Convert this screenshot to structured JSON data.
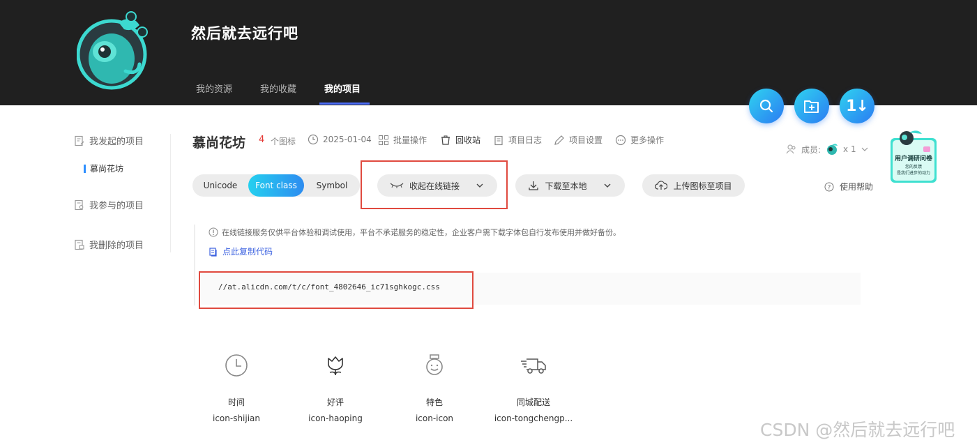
{
  "header": {
    "user_name": "然后就去远行吧",
    "tabs": [
      {
        "label": "我的资源"
      },
      {
        "label": "我的收藏"
      },
      {
        "label": "我的项目"
      }
    ],
    "actions": {
      "search_icon": "search-icon",
      "new_folder_icon": "folder-plus-icon",
      "sort_label": "1↓"
    }
  },
  "sidebar": {
    "initiated": "我发起的项目",
    "current_project": "慕尚花坊",
    "participated": "我参与的项目",
    "deleted": "我删除的项目"
  },
  "project": {
    "title": "慕尚花坊",
    "icon_count": "4",
    "icon_count_label": "个图标",
    "date": "2025-01-04",
    "batch_ops": "批量操作",
    "recycle": "回收站",
    "log": "项目日志",
    "settings": "项目设置",
    "more": "更多操作",
    "members_label": "成员:",
    "members_count": "x 1",
    "survey_title": "用户调研问卷",
    "survey_line1": "您的反馈",
    "survey_line2": "是我们进步的动力"
  },
  "toolbar": {
    "segments": [
      "Unicode",
      "Font class",
      "Symbol"
    ],
    "active_segment": "Font class",
    "collapse_link": "收起在线链接",
    "download": "下载至本地",
    "upload": "上传图标至项目",
    "help": "使用帮助"
  },
  "notice": {
    "text": "在线链接服务仅供平台体验和调试使用，平台不承诺服务的稳定性，企业客户需下载字体包自行发布使用并做好备份。",
    "copy_code": "点此复制代码"
  },
  "code": {
    "url": "//at.alicdn.com/t/c/font_4802646_ic71sghkogc.css"
  },
  "icons": [
    {
      "name": "时间",
      "class": "icon-shijian",
      "glyph": "clock-icon"
    },
    {
      "name": "好评",
      "class": "icon-haoping",
      "glyph": "tulip-icon"
    },
    {
      "name": "特色",
      "class": "icon-icon",
      "glyph": "medal-icon"
    },
    {
      "name": "同城配送",
      "class": "icon-tongchengp...",
      "glyph": "truck-icon"
    }
  ],
  "watermark": "CSDN @然后就去远行吧",
  "colors": {
    "header_bg": "#202020",
    "accent_blue": "#2d8cf0",
    "accent_cyan": "#25d0ef",
    "highlight_red": "#e04a3f",
    "count_red": "#e53935"
  }
}
